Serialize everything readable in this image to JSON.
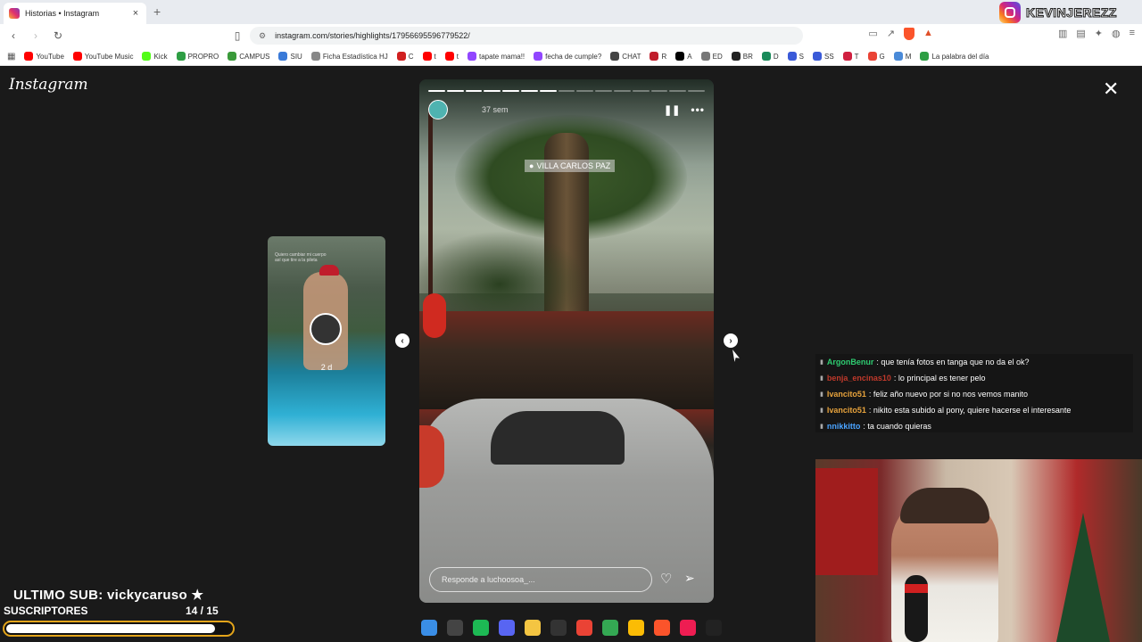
{
  "browser": {
    "tab_title": "Historias • Instagram",
    "tab_close": "×",
    "new_tab": "+",
    "url": "instagram.com/stories/highlights/17956695596779522/",
    "bookmarks": [
      {
        "label": "YouTube",
        "color": "#ff0000"
      },
      {
        "label": "YouTube Music",
        "color": "#ff0000"
      },
      {
        "label": "Kick",
        "color": "#53fc18"
      },
      {
        "label": "PROPRO",
        "color": "#2e9e44"
      },
      {
        "label": "CAMPUS",
        "color": "#3a9a3a"
      },
      {
        "label": "SIU",
        "color": "#3a7ad8"
      },
      {
        "label": "Ficha Estadística HJ",
        "color": "#888888"
      },
      {
        "label": "C",
        "color": "#d02020"
      },
      {
        "label": "t",
        "color": "#ff0000"
      },
      {
        "label": "t",
        "color": "#ff0000"
      },
      {
        "label": "tapate mama!!",
        "color": "#9146ff"
      },
      {
        "label": "fecha de cumple?",
        "color": "#9146ff"
      },
      {
        "label": "CHAT",
        "color": "#444444"
      },
      {
        "label": "R",
        "color": "#c01d2b"
      },
      {
        "label": "A",
        "color": "#000000"
      },
      {
        "label": "ED",
        "color": "#777777"
      },
      {
        "label": "BR",
        "color": "#222222"
      },
      {
        "label": "D",
        "color": "#1a8a5a"
      },
      {
        "label": "S",
        "color": "#3a5ad8"
      },
      {
        "label": "SS",
        "color": "#3a5ad8"
      },
      {
        "label": "T",
        "color": "#d02040"
      },
      {
        "label": "G",
        "color": "#ea4335"
      },
      {
        "label": "M",
        "color": "#4a8ad8"
      },
      {
        "label": "La palabra del día",
        "color": "#2e9e44"
      }
    ]
  },
  "stream_brand": "KEVINJEREZZ",
  "instagram": {
    "wordmark": "Instagram",
    "close": "✕",
    "prev_story": {
      "time": "2 d",
      "caption": "Quiero cambiar mi cuerpo así que tire a la pileta"
    },
    "story": {
      "time_ago": "37 sem",
      "location": "VILLA CARLOS PAZ",
      "reply_placeholder": "Responde a luchoosoa_...",
      "segments_total": 15,
      "segments_done": 7,
      "pause_icon": "❚❚",
      "more_icon": "•••"
    }
  },
  "chat": [
    {
      "user": "ArgonBenur",
      "color": "#2ecc71",
      "msg": ": que tenía fotos en tanga que no da el ok?"
    },
    {
      "user": "benja_encinas10",
      "color": "#c0392b",
      "msg": ": lo principal es tener pelo"
    },
    {
      "user": "Ivancito51",
      "color": "#e6a23c",
      "msg": ": feliz año nuevo por si no nos vemos manito"
    },
    {
      "user": "Ivancito51",
      "color": "#e6a23c",
      "msg": ": nikito esta subido al pony, quiere hacerse el interesante"
    },
    {
      "user": "nnikkitto",
      "color": "#4aa3ff",
      "msg": ": ta cuando quieras"
    }
  ],
  "overlay": {
    "last_sub": "ULTIMO SUB: vickycaruso ★",
    "subs_label": "SUSCRIPTORES",
    "subs_count": "14  / 15",
    "subs_progress": 0.93
  },
  "taskbar": [
    {
      "name": "windows-start-icon",
      "color": "#3a8ee6"
    },
    {
      "name": "search-icon",
      "color": "#444444"
    },
    {
      "name": "spotify-icon",
      "color": "#1db954"
    },
    {
      "name": "discord-icon",
      "color": "#5865f2"
    },
    {
      "name": "file-explorer-icon",
      "color": "#f4c542"
    },
    {
      "name": "steam-icon",
      "color": "#333333"
    },
    {
      "name": "chrome-icon",
      "color": "#ea4335"
    },
    {
      "name": "chrome-icon-2",
      "color": "#34a853"
    },
    {
      "name": "chrome-icon-3",
      "color": "#fbbc05"
    },
    {
      "name": "brave-icon",
      "color": "#fb542b"
    },
    {
      "name": "tiktok-icon",
      "color": "#ee1d52"
    },
    {
      "name": "epic-games-icon",
      "color": "#222222"
    }
  ]
}
